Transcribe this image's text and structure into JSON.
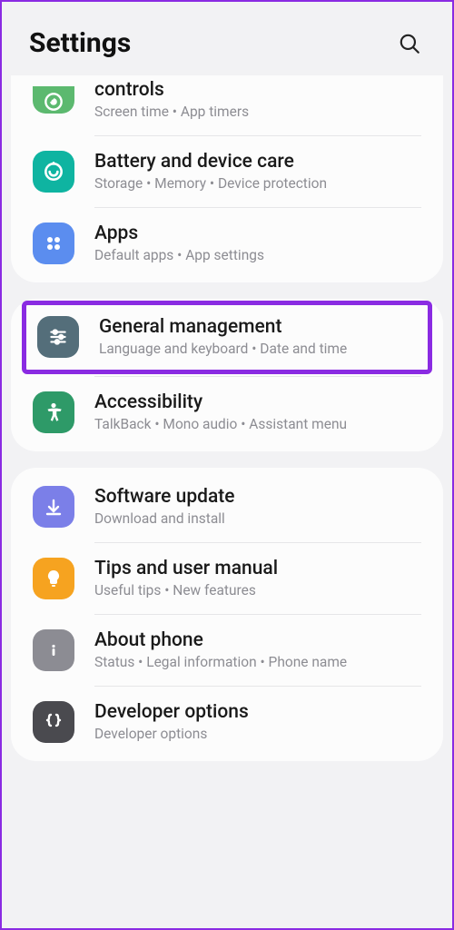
{
  "header": {
    "title": "Settings"
  },
  "items": {
    "controls": {
      "title": "controls",
      "sub": "Screen time  •  App timers"
    },
    "battery": {
      "title": "Battery and device care",
      "sub": "Storage  •  Memory  •  Device protection"
    },
    "apps": {
      "title": "Apps",
      "sub": "Default apps  •  App settings"
    },
    "general": {
      "title": "General management",
      "sub": "Language and keyboard  •  Date and time"
    },
    "access": {
      "title": "Accessibility",
      "sub": "TalkBack  •  Mono audio  •  Assistant menu"
    },
    "software": {
      "title": "Software update",
      "sub": "Download and install"
    },
    "tips": {
      "title": "Tips and user manual",
      "sub": "Useful tips  •  New features"
    },
    "about": {
      "title": "About phone",
      "sub": "Status  •  Legal information  •  Phone name"
    },
    "developer": {
      "title": "Developer options",
      "sub": "Developer options"
    }
  }
}
